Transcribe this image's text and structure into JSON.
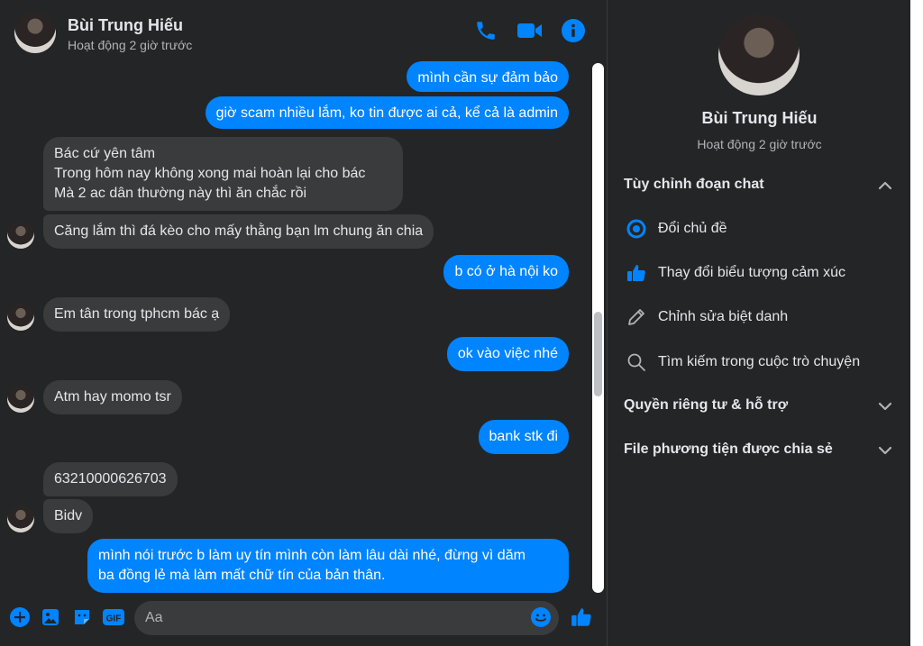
{
  "contact": {
    "name": "Bùi Trung Hiếu",
    "status": "Hoạt động 2 giờ trước"
  },
  "header_icons": [
    "phone-icon",
    "video-icon",
    "info-icon"
  ],
  "messages": [
    {
      "dir": "sent",
      "text": "mình cần sự đảm bảo"
    },
    {
      "dir": "sent",
      "text": "giờ scam nhiều lắm, ko tin được ai cả, kể cả là admin"
    },
    {
      "dir": "recv",
      "text": "Bác cứ yên tâm\nTrong hôm nay không xong mai hoàn lại cho bác\nMà 2 ac dân thường này thì ăn chắc rồi"
    },
    {
      "dir": "recv",
      "text": "Căng lắm thì đá kèo cho mấy thằng bạn lm chung ăn chia"
    },
    {
      "dir": "sent",
      "text": "b có ở hà nội ko"
    },
    {
      "dir": "recv",
      "text": "Em tân trong tphcm bác ạ"
    },
    {
      "dir": "sent",
      "text": "ok vào việc nhé"
    },
    {
      "dir": "recv",
      "text": "Atm hay momo tsr"
    },
    {
      "dir": "sent",
      "text": "bank stk đi"
    },
    {
      "dir": "recv",
      "text": "63210000626703"
    },
    {
      "dir": "recv",
      "text": "Bidv"
    },
    {
      "dir": "sent",
      "text": "mình nói trước b làm uy tín mình còn làm lâu dài nhé, đừng vì dăm\nba đồng lẻ mà làm mất chữ tín của bản thân."
    }
  ],
  "composer": {
    "placeholder": "Aa",
    "icons": [
      "add-icon",
      "image-icon",
      "sticker-icon",
      "gif-icon",
      "emoji-icon",
      "like-icon"
    ],
    "gif_label": "GIF"
  },
  "panel": {
    "sections": {
      "customize": "Tùy chỉnh đoạn chat",
      "privacy": "Quyền riêng tư & hỗ trợ",
      "media": "File phương tiện được chia sẻ"
    },
    "items": [
      {
        "label": "Đổi chủ đề",
        "icon": "theme-icon"
      },
      {
        "label": "Thay đổi biểu tượng cảm xúc",
        "icon": "thumbs-up-icon"
      },
      {
        "label": "Chỉnh sửa biệt danh",
        "icon": "pencil-icon"
      },
      {
        "label": "Tìm kiếm trong cuộc trò chuyện",
        "icon": "search-icon"
      }
    ]
  },
  "colors": {
    "accent": "#0084ff",
    "background": "#242526",
    "bubble_received": "#3a3b3c",
    "text": "#e4e6eb",
    "muted_text": "#b0b3b8"
  }
}
